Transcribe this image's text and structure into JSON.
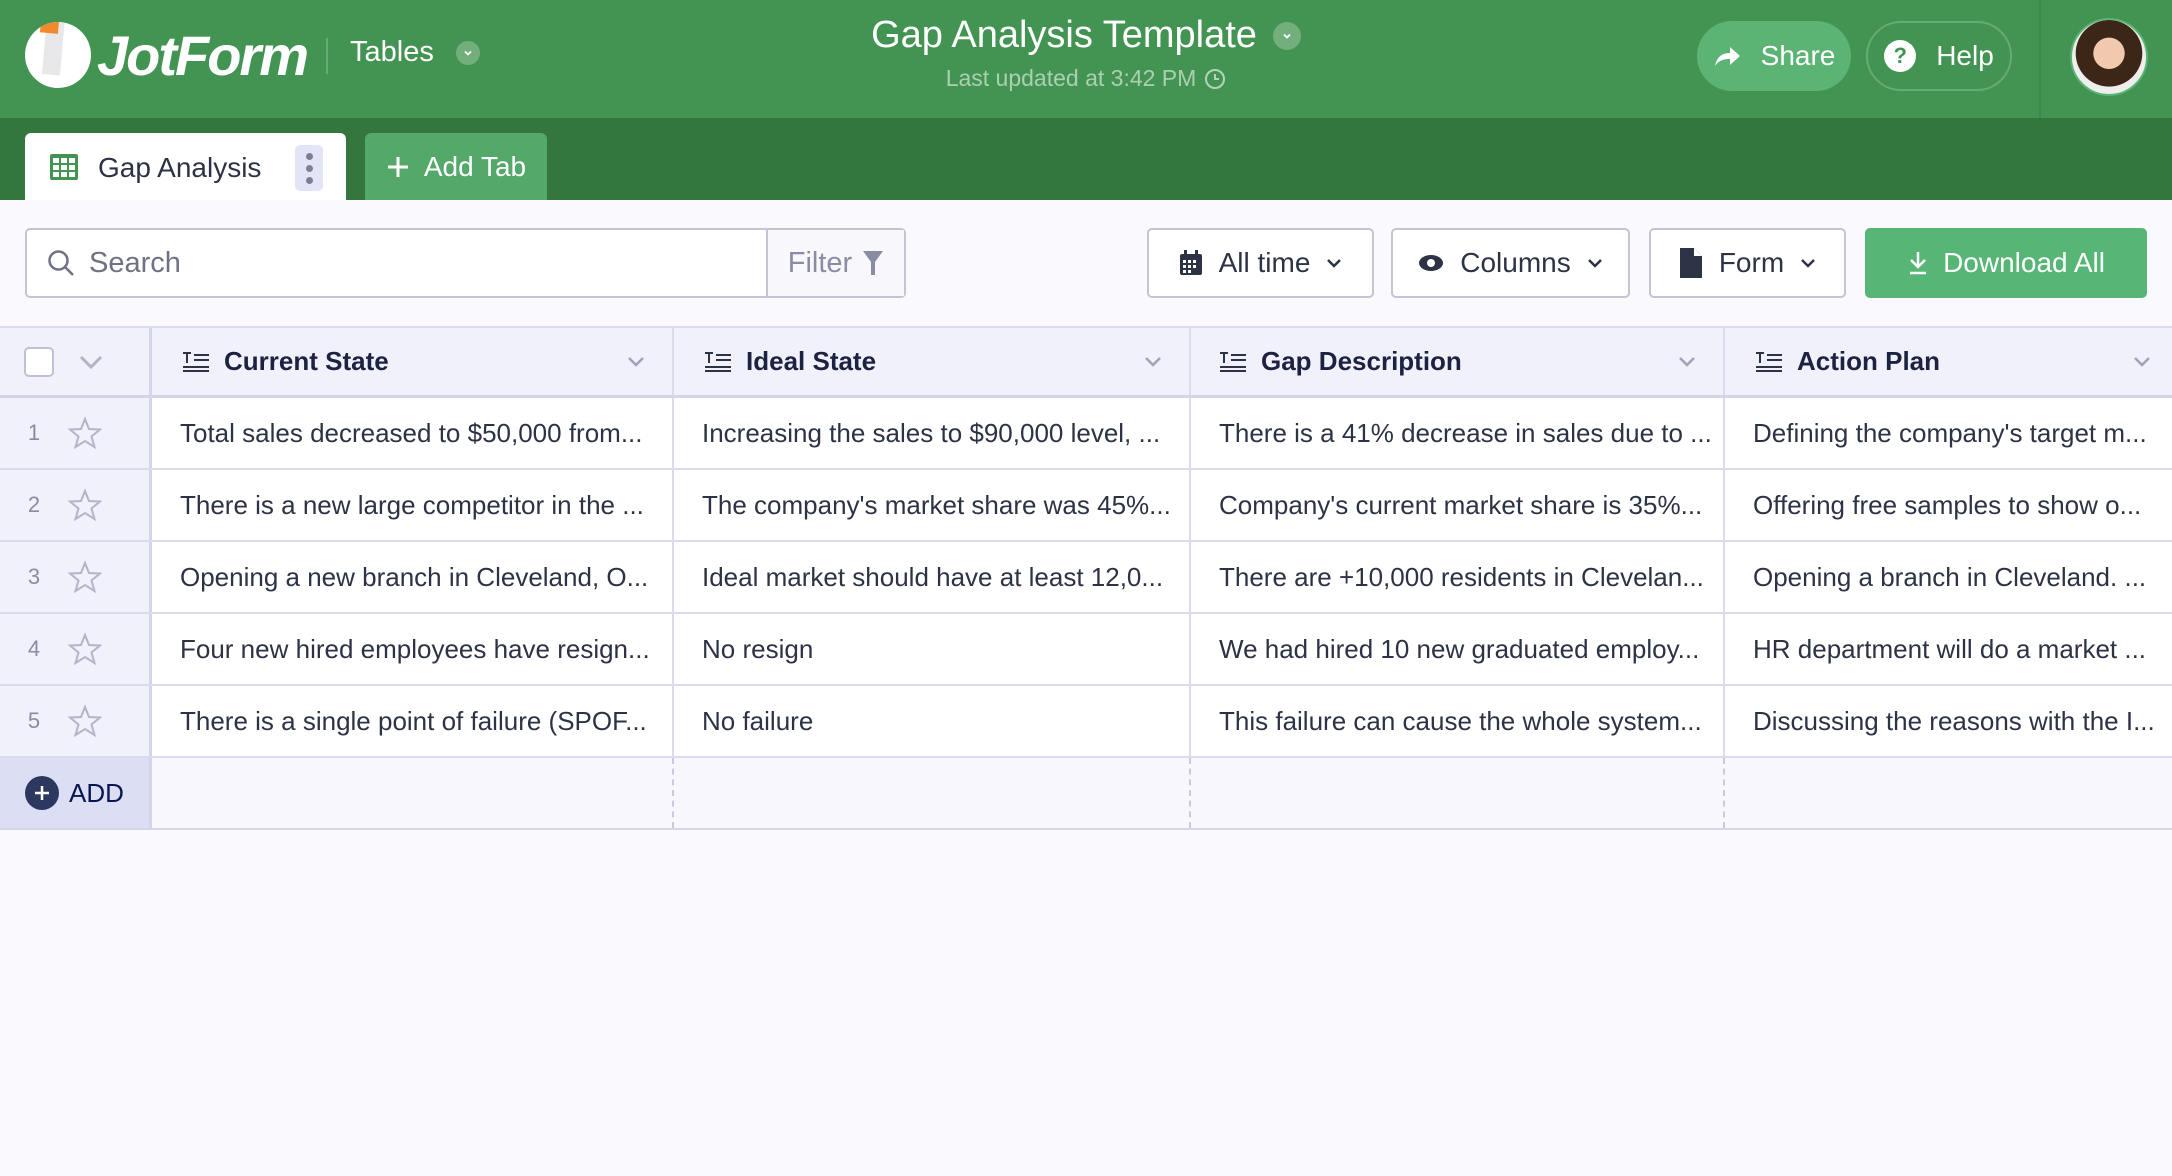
{
  "header": {
    "brand": "JotForm",
    "product": "Tables",
    "title": "Gap Analysis Template",
    "last_updated": "Last updated at 3:42 PM",
    "share_label": "Share",
    "help_label": "Help",
    "help_glyph": "?",
    "colors": {
      "header_bg": "#439452",
      "tabbar_bg": "#33773e",
      "accent": "#57b676"
    }
  },
  "tabs": {
    "items": [
      {
        "label": "Gap Analysis",
        "icon": "table-grid-icon",
        "active": true
      }
    ],
    "add_tab_label": "Add Tab"
  },
  "toolbar": {
    "search_placeholder": "Search",
    "search_value": "",
    "filter_label": "Filter",
    "date_range_label": "All time",
    "columns_label": "Columns",
    "form_label": "Form",
    "download_label": "Download All"
  },
  "table": {
    "columns": [
      {
        "label": "Current State",
        "type_icon": "text-field-icon"
      },
      {
        "label": "Ideal State",
        "type_icon": "text-field-icon"
      },
      {
        "label": "Gap Description",
        "type_icon": "text-field-icon"
      },
      {
        "label": "Action Plan",
        "type_icon": "text-field-icon"
      }
    ],
    "rows": [
      {
        "num": "1",
        "starred": false,
        "cells": [
          "Total sales decreased to $50,000 from...",
          "Increasing the sales to $90,000 level, ...",
          "There is a 41% decrease in sales due to ...",
          "Defining the company's target m..."
        ]
      },
      {
        "num": "2",
        "starred": false,
        "cells": [
          "There is a new large competitor in the ...",
          "The company's market share was 45%...",
          "Company's current market share is 35%...",
          "Offering free samples to show o..."
        ]
      },
      {
        "num": "3",
        "starred": false,
        "cells": [
          "Opening a new branch in Cleveland, O...",
          "Ideal market should have at least 12,0...",
          "There are +10,000 residents in Clevelan...",
          "Opening a branch in Cleveland. ..."
        ]
      },
      {
        "num": "4",
        "starred": false,
        "cells": [
          "Four new hired employees have resign...",
          "No resign",
          "We had hired 10 new graduated employ...",
          "HR department will do a market ..."
        ]
      },
      {
        "num": "5",
        "starred": false,
        "cells": [
          "There is a single point of failure (SPOF...",
          "No failure",
          "This failure can cause the whole system...",
          "Discussing the reasons with the I..."
        ]
      }
    ],
    "add_label": "ADD"
  }
}
